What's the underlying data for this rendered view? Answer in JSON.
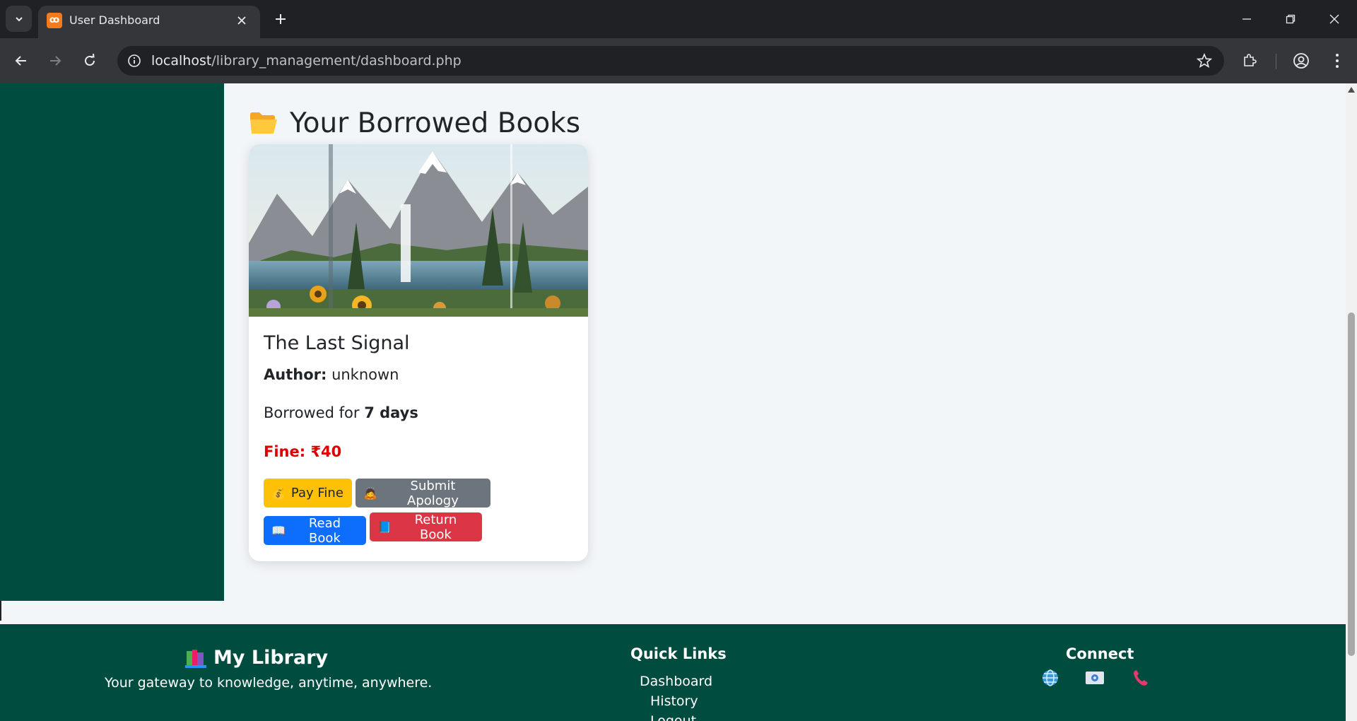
{
  "browser": {
    "tab_title": "User Dashboard",
    "favicon_text": "ꝏ",
    "url_host": "localhost",
    "url_path": "/library_management/dashboard.php"
  },
  "page": {
    "section_title": "Your Borrowed Books",
    "section_icon": "folder-open-icon"
  },
  "book": {
    "title": "The Last Signal",
    "author_label": "Author:",
    "author": "unknown",
    "borrowed_prefix": "Borrowed for",
    "borrowed_duration": "7 days",
    "fine_label": "Fine: ₹40",
    "buttons": {
      "pay_fine": "Pay Fine",
      "submit_apology": "Submit Apology",
      "read_book": "Read Book",
      "return_book": "Return Book"
    }
  },
  "footer": {
    "brand": "My Library",
    "tagline": "Your gateway to knowledge, anytime, anywhere.",
    "quick_links_title": "Quick Links",
    "quick_links": [
      "Dashboard",
      "History",
      "Logout"
    ],
    "connect_title": "Connect",
    "connect_icons": [
      "globe-icon",
      "email-icon",
      "phone-icon"
    ]
  },
  "colors": {
    "sidebar": "#004d40",
    "footer": "#004d40",
    "pay_button": "#ffc107",
    "apology_button": "#6c757d",
    "read_button": "#0d6efd",
    "return_button": "#dc3545",
    "fine_text": "#e00000"
  }
}
